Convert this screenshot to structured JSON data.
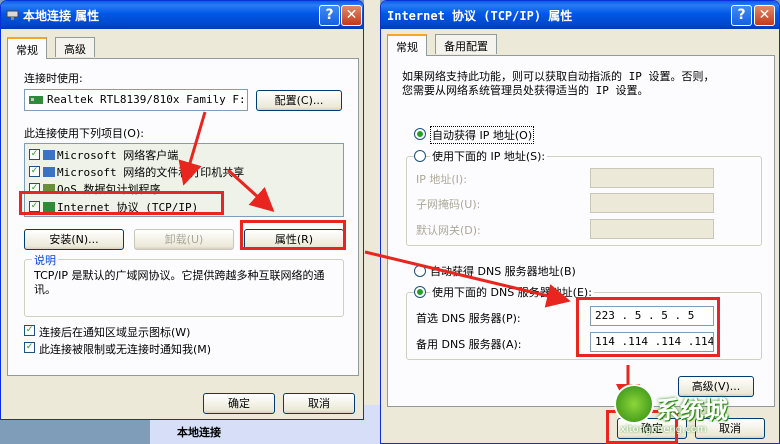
{
  "left_dialog": {
    "title": "本地连接  属性",
    "tabs": [
      "常规",
      "高级"
    ],
    "connect_using_label": "连接时使用:",
    "adapter_name": "Realtek RTL8139/810x Family F:",
    "configure_button": "配置(C)...",
    "items_label": "此连接使用下列项目(O):",
    "items": [
      {
        "label": "Microsoft 网络客户端",
        "checked": true
      },
      {
        "label": "Microsoft 网络的文件和打印机共享",
        "checked": true
      },
      {
        "label": "QoS 数据包计划程序",
        "checked": true
      },
      {
        "label": "Internet 协议 (TCP/IP)",
        "checked": true
      }
    ],
    "install_button": "安装(N)...",
    "uninstall_button": "卸载(U)",
    "properties_button": "属性(R)",
    "description_label": "说明",
    "description_text": "TCP/IP 是默认的广域网协议。它提供跨越多种互联网络的通讯。",
    "notify_icon_label": "连接后在通知区域显示图标(W)",
    "notify_limited_label": "此连接被限制或无连接时通知我(M)",
    "ok_button": "确定",
    "cancel_button": "取消"
  },
  "background": {
    "panel_title": "本地连接"
  },
  "right_dialog": {
    "title": "Internet 协议 (TCP/IP) 属性",
    "tabs": [
      "常规",
      "备用配置"
    ],
    "intro_line1": "如果网络支持此功能，则可以获取自动指派的 IP 设置。否则，",
    "intro_line2": "您需要从网络系统管理员处获得适当的 IP 设置。",
    "auto_ip_label": "自动获得 IP 地址(O)",
    "manual_ip_label": "使用下面的 IP 地址(S):",
    "ip_address_label": "IP 地址(I):",
    "subnet_label": "子网掩码(U):",
    "gateway_label": "默认网关(D):",
    "auto_dns_label": "自动获得 DNS 服务器地址(B)",
    "manual_dns_label": "使用下面的 DNS 服务器地址(E):",
    "preferred_dns_label": "首选 DNS 服务器(P):",
    "preferred_dns_value": "223 . 5 . 5 . 5",
    "alternate_dns_label": "备用 DNS 服务器(A):",
    "alternate_dns_value": "114 .114 .114 .114",
    "advanced_button": "高级(V)...",
    "ok_button": "确定",
    "cancel_button": "取消"
  },
  "watermark": {
    "text": "系统城",
    "url": "xitongcheng.com"
  },
  "colors": {
    "annotation_red": "#e8251e",
    "titlebar_blue": "#0058e6",
    "dialog_bg": "#ece9d8"
  }
}
